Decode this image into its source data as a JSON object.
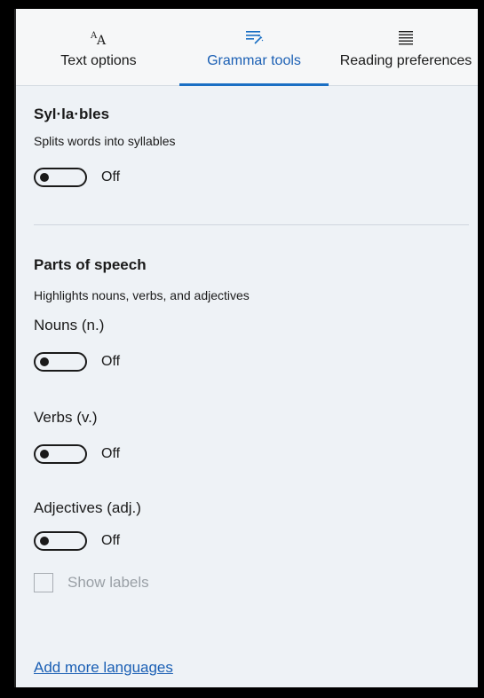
{
  "tabs": [
    {
      "label": "Text options",
      "icon": "text-size-icon",
      "active": false
    },
    {
      "label": "Grammar tools",
      "icon": "grammar-tools-icon",
      "active": true
    },
    {
      "label": "Reading preferences",
      "icon": "reading-preferences-icon",
      "active": false
    }
  ],
  "syllables": {
    "title": "Syl·la·bles",
    "description": "Splits words into syllables",
    "toggle_state": "Off"
  },
  "parts_of_speech": {
    "title": "Parts of speech",
    "description": "Highlights nouns, verbs, and adjectives",
    "nouns": {
      "label": "Nouns (n.)",
      "toggle_state": "Off"
    },
    "verbs": {
      "label": "Verbs (v.)",
      "toggle_state": "Off"
    },
    "adjectives": {
      "label": "Adjectives (adj.)",
      "toggle_state": "Off"
    },
    "show_labels": {
      "label": "Show labels",
      "checked": false,
      "enabled": false
    }
  },
  "footer": {
    "link": "Add more languages"
  },
  "colors": {
    "accent": "#1a6fc4",
    "panel_bg": "#eef2f6",
    "tab_bg": "#f6f7f8"
  }
}
